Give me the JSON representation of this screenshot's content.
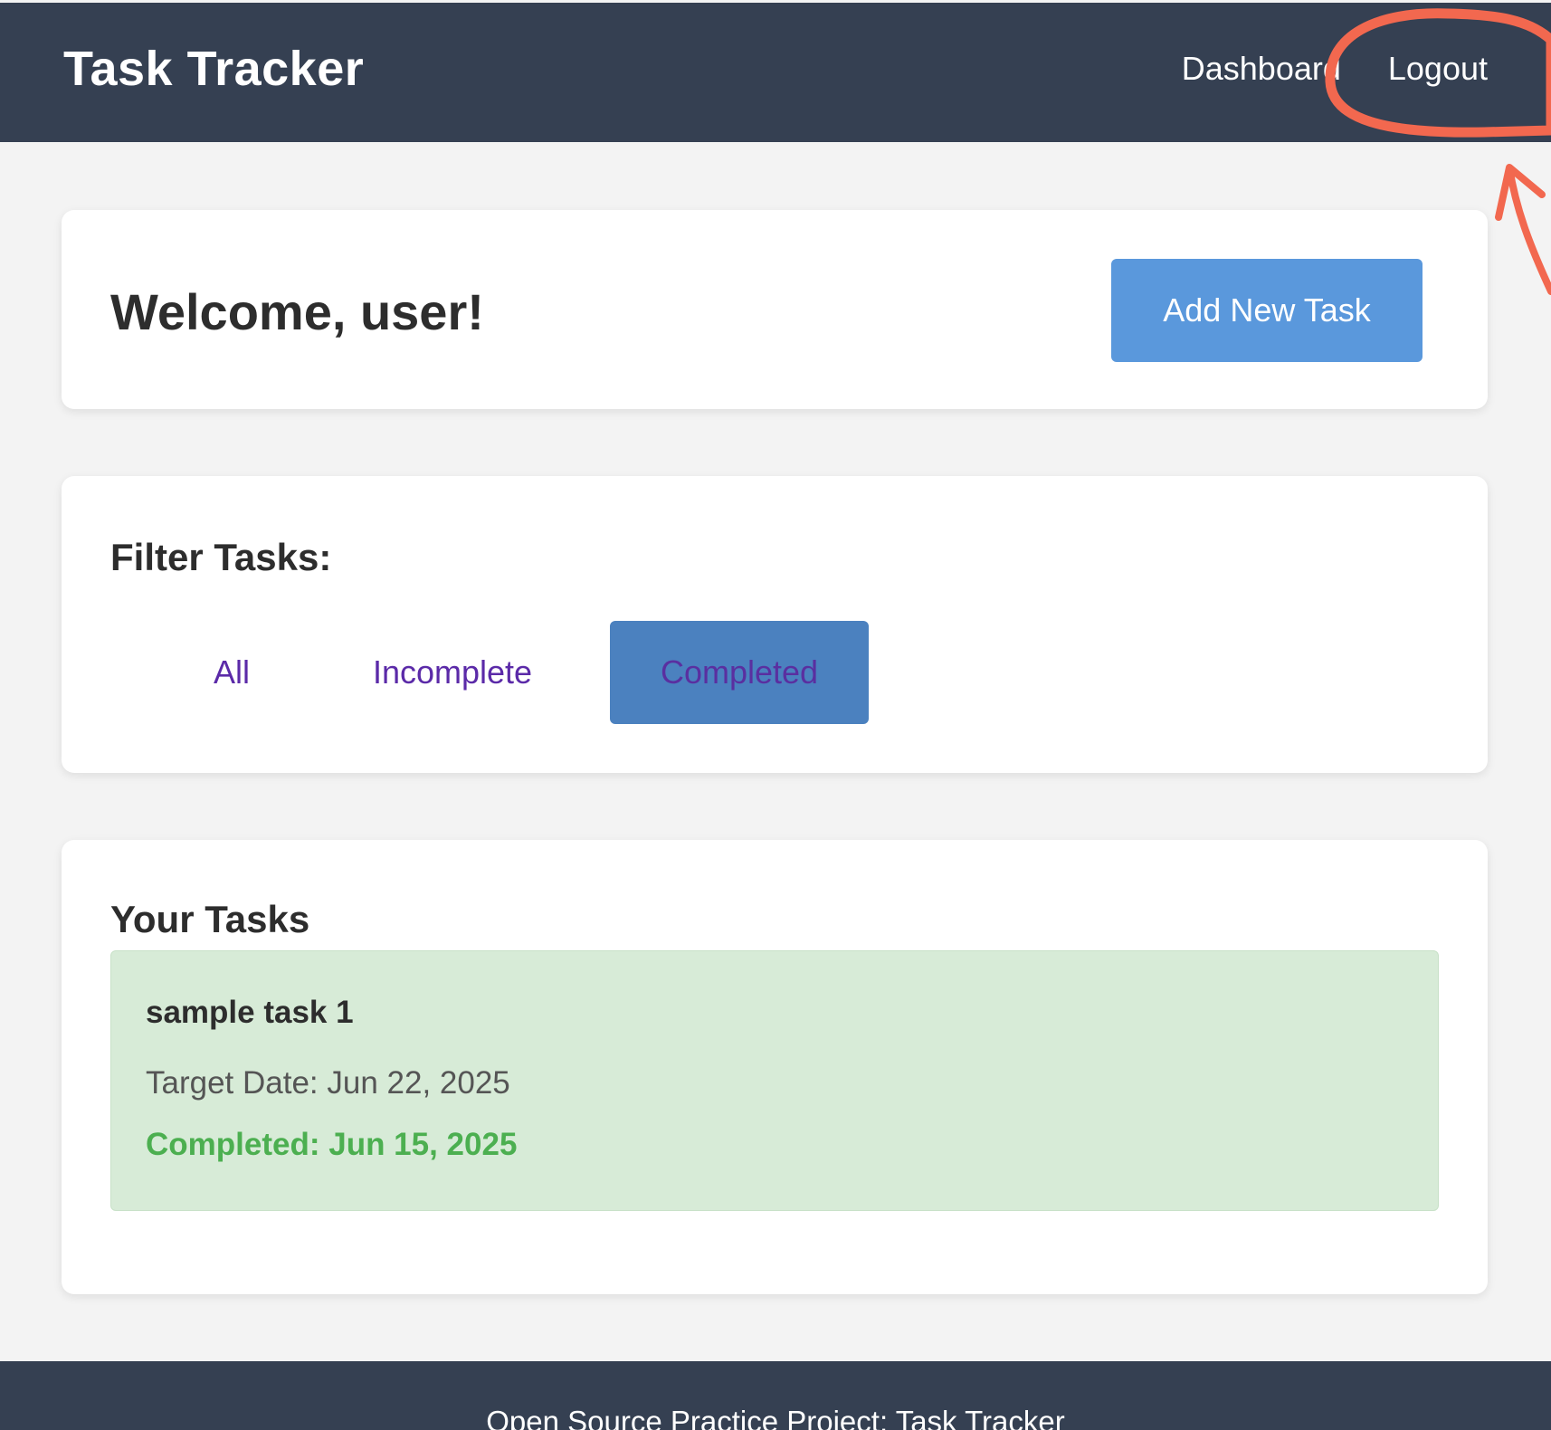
{
  "header": {
    "title": "Task Tracker",
    "nav": {
      "dashboard": "Dashboard",
      "logout": "Logout"
    }
  },
  "welcome": {
    "title": "Welcome, user!",
    "add_button": "Add New Task"
  },
  "filter": {
    "title": "Filter Tasks:",
    "options": {
      "all": "All",
      "incomplete": "Incomplete",
      "completed": "Completed"
    },
    "selected": "Completed"
  },
  "tasks": {
    "title": "Your Tasks",
    "items": [
      {
        "name": "sample task 1",
        "target_date": "Target Date: Jun 22, 2025",
        "completed": "Completed: Jun 15, 2025"
      }
    ]
  },
  "footer": {
    "text": "Open Source Practice Project: Task Tracker"
  },
  "colors": {
    "header_bg": "#354052",
    "accent_button": "#5a98dc",
    "active_filter": "#4b81bf",
    "completed_task_bg": "#d7ebd7",
    "completed_text": "#4caf50",
    "annotation": "#f2684f"
  }
}
